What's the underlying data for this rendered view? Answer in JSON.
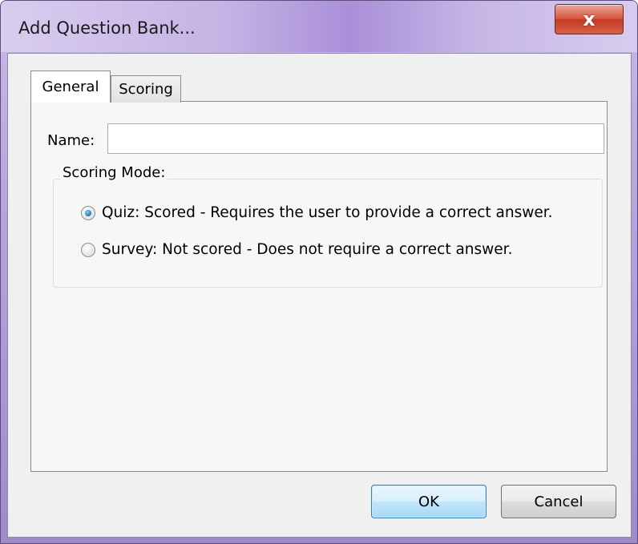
{
  "window": {
    "title": "Add Question Bank...",
    "close_glyph": "x"
  },
  "tabs": [
    {
      "label": "General",
      "selected": true
    },
    {
      "label": "Scoring",
      "selected": false
    }
  ],
  "form": {
    "name_label": "Name:",
    "name_value": "",
    "scoring_mode": {
      "legend": "Scoring Mode:",
      "options": [
        {
          "label": "Quiz: Scored - Requires the user to provide a correct answer.",
          "checked": true
        },
        {
          "label": "Survey: Not scored - Does not require a correct answer.",
          "checked": false
        }
      ]
    }
  },
  "buttons": {
    "ok": "OK",
    "cancel": "Cancel"
  },
  "colors": {
    "accent_blue": "#3c7fb1",
    "close_red": "#c23a24",
    "titlebar": "#b7a3dc"
  }
}
